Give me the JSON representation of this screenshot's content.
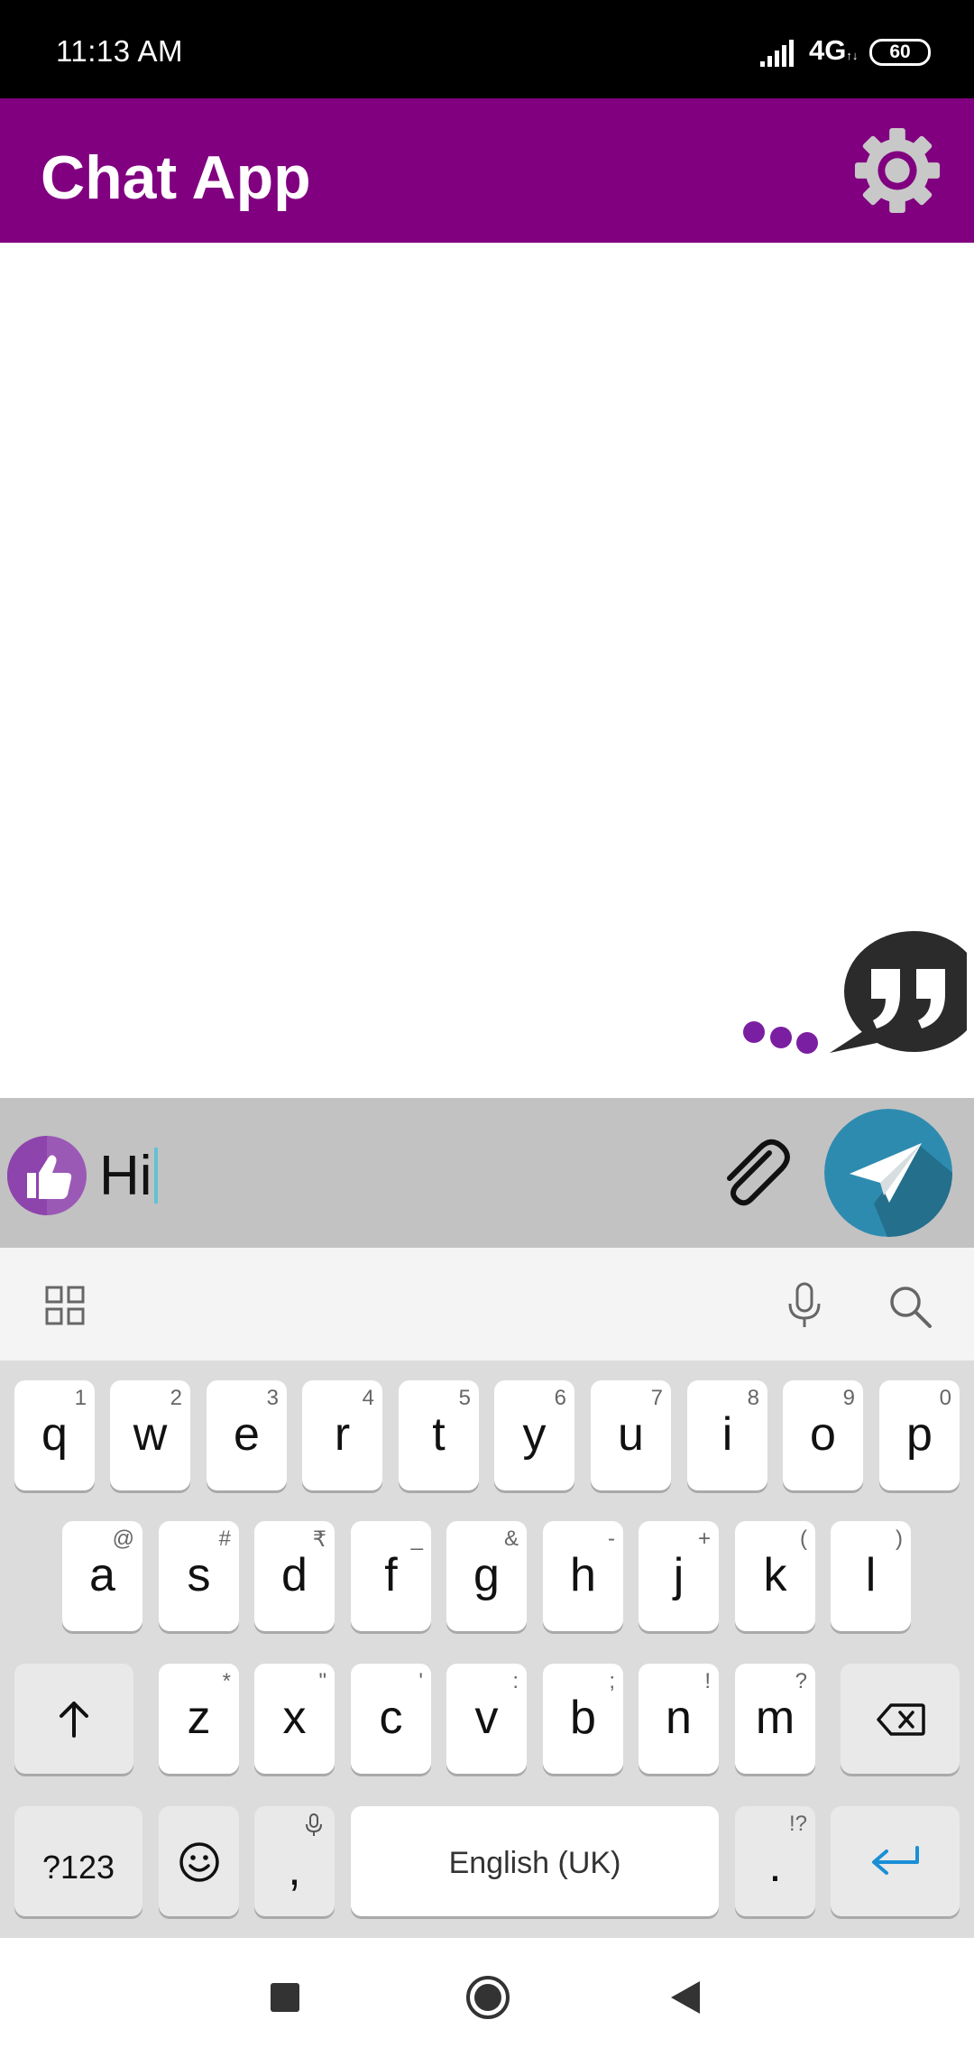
{
  "status_bar": {
    "time": "11:13 AM",
    "network": "4G",
    "battery": "60"
  },
  "app_bar": {
    "title": "Chat App",
    "settings_icon": "gear-icon"
  },
  "composer": {
    "text": "Hi",
    "like_icon": "thumbs-up-icon",
    "attach_icon": "paperclip-icon",
    "send_icon": "paper-plane-icon"
  },
  "keyboard": {
    "row1": [
      {
        "key": "q",
        "hint": "1"
      },
      {
        "key": "w",
        "hint": "2"
      },
      {
        "key": "e",
        "hint": "3"
      },
      {
        "key": "r",
        "hint": "4"
      },
      {
        "key": "t",
        "hint": "5"
      },
      {
        "key": "y",
        "hint": "6"
      },
      {
        "key": "u",
        "hint": "7"
      },
      {
        "key": "i",
        "hint": "8"
      },
      {
        "key": "o",
        "hint": "9"
      },
      {
        "key": "p",
        "hint": "0"
      }
    ],
    "row2": [
      {
        "key": "a",
        "hint": "@"
      },
      {
        "key": "s",
        "hint": "#"
      },
      {
        "key": "d",
        "hint": "₹"
      },
      {
        "key": "f",
        "hint": "_"
      },
      {
        "key": "g",
        "hint": "&"
      },
      {
        "key": "h",
        "hint": "-"
      },
      {
        "key": "j",
        "hint": "+"
      },
      {
        "key": "k",
        "hint": "("
      },
      {
        "key": "l",
        "hint": ")"
      }
    ],
    "row3": [
      {
        "key": "z",
        "hint": "*"
      },
      {
        "key": "x",
        "hint": "\""
      },
      {
        "key": "c",
        "hint": "'"
      },
      {
        "key": "v",
        "hint": ":"
      },
      {
        "key": "b",
        "hint": ";"
      },
      {
        "key": "n",
        "hint": "!"
      },
      {
        "key": "m",
        "hint": "?"
      }
    ],
    "symbols_label": "?123",
    "comma": ",",
    "space_label": "English (UK)",
    "period": ".",
    "period_hint": "!?"
  }
}
